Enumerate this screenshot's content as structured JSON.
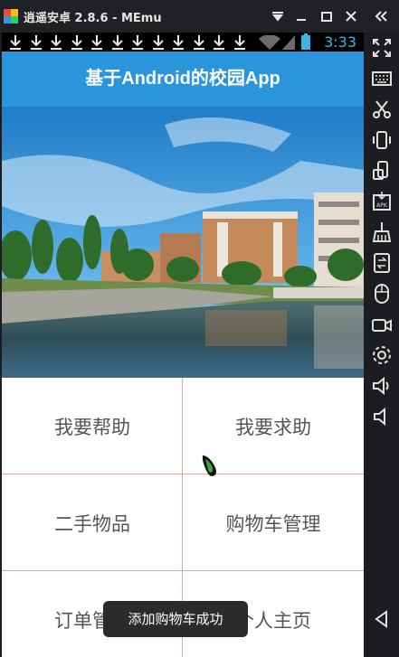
{
  "window": {
    "title": "逍遥安卓 2.8.6 - MEmu",
    "controls": [
      "pin-icon",
      "minimize-icon",
      "maximize-icon",
      "close-icon",
      "collapse-sidebar-icon"
    ]
  },
  "statusbar": {
    "time": "3:33",
    "notification_icons": [
      "download-icon",
      "download-icon",
      "download-icon",
      "download-icon",
      "download-icon",
      "download-icon",
      "download-icon",
      "download-icon",
      "download-icon",
      "download-icon",
      "download-icon",
      "download-icon"
    ],
    "wifi": "wifi-icon",
    "signal": "signal-icon",
    "battery": "battery-icon"
  },
  "app": {
    "title": "基于Android的校园App",
    "accent_color": "#2b95dc",
    "divider_color": "#e0a89a"
  },
  "menu": {
    "items": [
      {
        "label": "我要帮助"
      },
      {
        "label": "我要求助"
      },
      {
        "label": "二手物品"
      },
      {
        "label": "购物车管理"
      },
      {
        "label": "订单管理"
      },
      {
        "label": "个人主页"
      }
    ]
  },
  "toast": {
    "text": "添加购物车成功"
  },
  "sidebar": {
    "tools": [
      "fullscreen-icon",
      "keyboard-icon",
      "scissors-icon",
      "shake-icon",
      "rotate-icon",
      "apk-icon",
      "broom-icon",
      "transfer-icon",
      "mouse-icon",
      "video-record-icon",
      "settings-icon",
      "volume-up-icon",
      "volume-down-icon",
      "back-icon"
    ]
  }
}
